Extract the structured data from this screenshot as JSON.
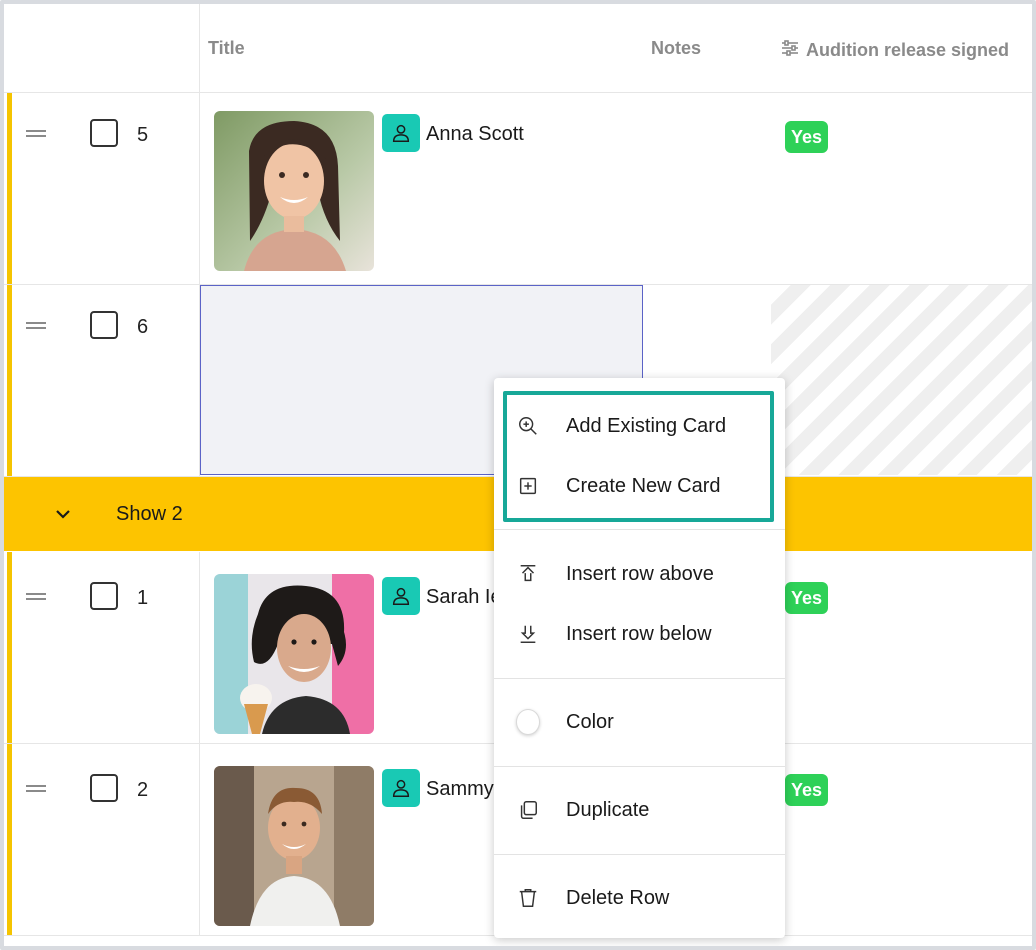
{
  "header": {
    "title_col": "Title",
    "notes_col": "Notes",
    "audition_col": "Audition release signed",
    "audition_icon": "sliders-icon"
  },
  "rows": [
    {
      "number": "5",
      "name": "Anna Scott",
      "audition": "Yes",
      "photo": "woman-smiling-photo"
    },
    {
      "number": "6",
      "name": "",
      "audition": "",
      "photo": ""
    },
    {
      "number": "1",
      "name": "Sarah Ie",
      "audition": "Yes",
      "photo": "woman-ice-cream-photo"
    },
    {
      "number": "2",
      "name": "Sammy",
      "audition": "Yes",
      "photo": "man-smiling-photo"
    }
  ],
  "group": {
    "label": "Show 2",
    "icon": "chevron-down-icon"
  },
  "menu": {
    "items": [
      {
        "label": "Add Existing Card",
        "icon": "zoom-in-icon"
      },
      {
        "label": "Create New Card",
        "icon": "plus-square-icon"
      },
      {
        "label": "Insert row above",
        "icon": "insert-above-icon"
      },
      {
        "label": "Insert row below",
        "icon": "insert-below-icon"
      },
      {
        "label": "Color",
        "icon": "color-circle-icon"
      },
      {
        "label": "Duplicate",
        "icon": "duplicate-icon"
      },
      {
        "label": "Delete Row",
        "icon": "trash-icon"
      }
    ]
  },
  "colors": {
    "row_accent": "#f5c400",
    "group_bar": "#fdc400",
    "avatar_chip": "#19c9b4",
    "yes_badge": "#2ed158",
    "highlight_box": "#17a898",
    "selection_border": "#5b63c7"
  }
}
